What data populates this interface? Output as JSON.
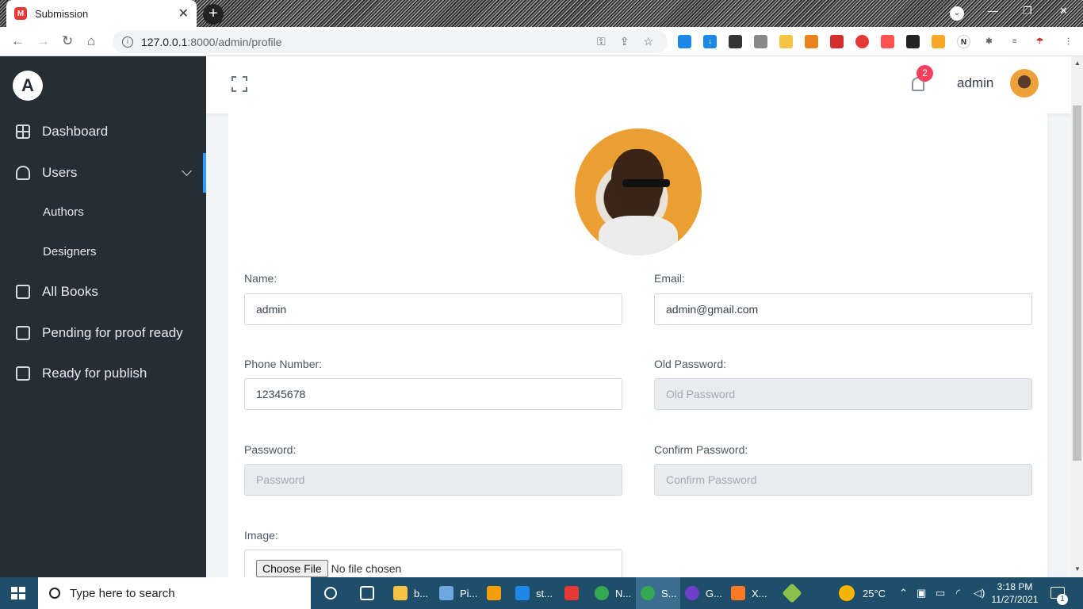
{
  "browser": {
    "tab_title": "Submission",
    "favicon_letter": "M",
    "url_host": "127.0.0.1",
    "url_rest": ":8000/admin/profile"
  },
  "sidebar": {
    "logo_letter": "A",
    "items": [
      {
        "label": "Dashboard",
        "icon": "grid-icon"
      },
      {
        "label": "Users",
        "icon": "user-icon"
      },
      {
        "label": "Authors"
      },
      {
        "label": "Designers"
      },
      {
        "label": "All Books",
        "icon": "book-icon"
      },
      {
        "label": "Pending for proof ready",
        "icon": "book-icon"
      },
      {
        "label": "Ready for publish",
        "icon": "book-icon"
      }
    ]
  },
  "header": {
    "notification_count": "2",
    "username": "admin"
  },
  "form": {
    "name_label": "Name:",
    "name_value": "admin",
    "email_label": "Email:",
    "email_value": "admin@gmail.com",
    "phone_label": "Phone Number:",
    "phone_value": "12345678",
    "old_password_label": "Old Password:",
    "old_password_placeholder": "Old Password",
    "password_label": "Password:",
    "password_placeholder": "Password",
    "confirm_password_label": "Confirm Password:",
    "confirm_password_placeholder": "Confirm Password",
    "image_label": "Image:",
    "file_button": "Choose File",
    "file_status": "No file chosen"
  },
  "taskbar": {
    "search_placeholder": "Type here to search",
    "apps": [
      "b...",
      "Pi...",
      "st...",
      "N...",
      "S...",
      "G...",
      "X..."
    ],
    "temperature": "25°C",
    "time": "3:18 PM",
    "date": "11/27/2021",
    "notification_count": "1"
  },
  "colors": {
    "sidebar_bg": "#252d35",
    "accent": "#2f9bff",
    "badge": "#f43f5e",
    "avatar_bg": "#eb9f32"
  }
}
